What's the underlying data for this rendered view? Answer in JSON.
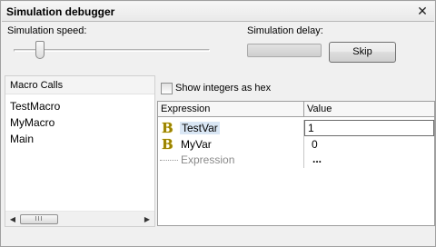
{
  "window": {
    "title": "Simulation debugger",
    "close_glyph": "✕"
  },
  "speed": {
    "label": "Simulation speed:",
    "value_fraction": 0.12
  },
  "delay": {
    "label": "Simulation delay:"
  },
  "skip_button": {
    "label": "Skip"
  },
  "macro_panel": {
    "header": "Macro Calls",
    "items": [
      "TestMacro",
      "MyMacro",
      "Main"
    ],
    "scroll_thumb_glyph": "III"
  },
  "hex_option": {
    "label": "Show integers as hex",
    "checked": false
  },
  "grid": {
    "columns": {
      "expression": "Expression",
      "value": "Value"
    },
    "rows": [
      {
        "icon": "bold-b-icon",
        "name": "TestVar",
        "value": "1",
        "selected": true
      },
      {
        "icon": "bold-b-icon",
        "name": "MyVar",
        "value": "0",
        "selected": false
      },
      {
        "icon": "placeholder",
        "name": "Expression",
        "value": "...",
        "placeholder": true
      }
    ]
  }
}
